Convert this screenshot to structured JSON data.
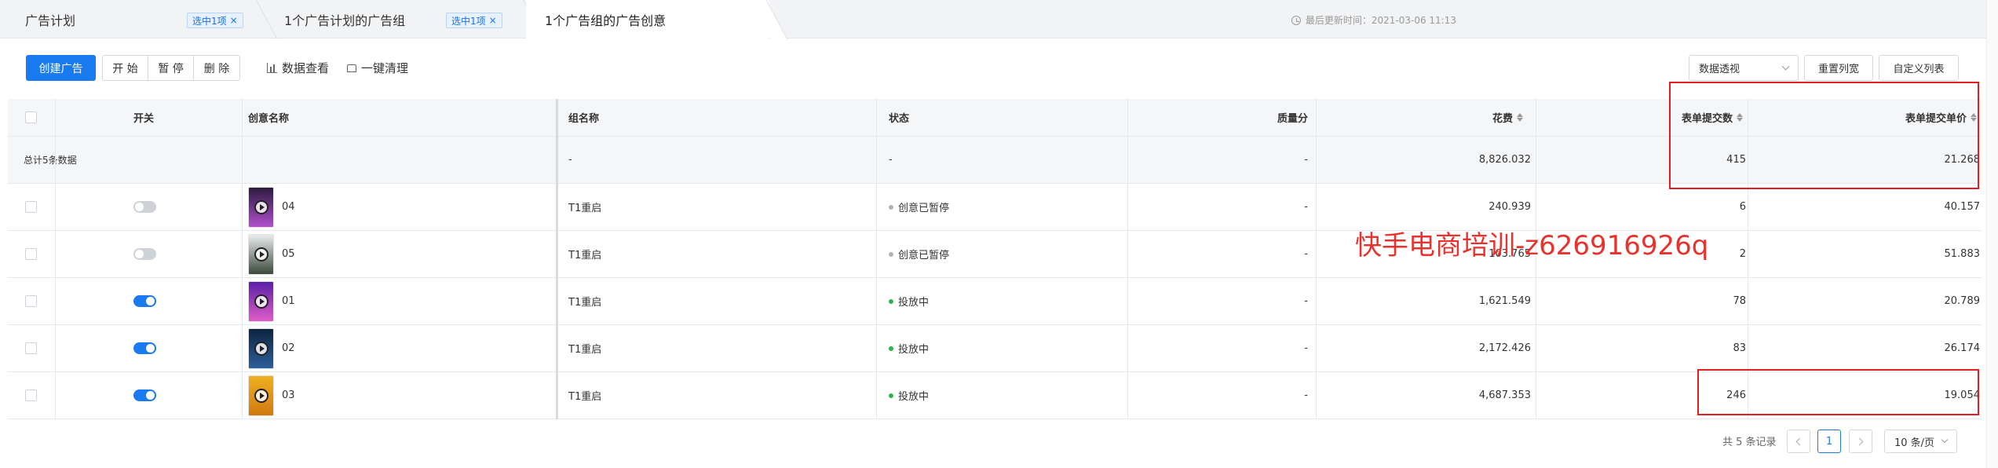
{
  "tabs": [
    {
      "label": "广告计划",
      "badge": "选中1项"
    },
    {
      "label": "1个广告计划的广告组",
      "badge": "选中1项"
    },
    {
      "label": "1个广告组的广告创意",
      "badge": ""
    }
  ],
  "last_update": "最后更新时间：2021-03-06 11:13",
  "toolbar": {
    "create": "创建广告",
    "start": "开 始",
    "pause": "暂 停",
    "delete": "删 除",
    "data_view": "数据查看",
    "one_click_clean": "一键清理",
    "select_value": "数据透视",
    "reset_width": "重置列宽",
    "custom_columns": "自定义列表"
  },
  "columns": {
    "switch": "开关",
    "creative_name": "创意名称",
    "group_name": "组名称",
    "status": "状态",
    "quality": "质量分",
    "spend": "花费",
    "form_submits": "表单提交数",
    "form_unit_price": "表单提交单价"
  },
  "total_row": {
    "label": "总计5条数据",
    "group_name": "-",
    "status": "-",
    "quality": "-",
    "spend": "8,826.032",
    "form_submits": "415",
    "form_unit_price": "21.268"
  },
  "rows": [
    {
      "on": false,
      "name": "04",
      "group": "T1重启",
      "status": "创意已暂停",
      "status_color": "#b0b3b8",
      "quality": "-",
      "spend": "240.939",
      "submits": "6",
      "unit_price": "40.157",
      "thumb_colors": [
        "#2b1b3d",
        "#b24fd0"
      ]
    },
    {
      "on": false,
      "name": "05",
      "group": "T1重启",
      "status": "创意已暂停",
      "status_color": "#b0b3b8",
      "quality": "-",
      "spend": "103.765",
      "submits": "2",
      "unit_price": "51.883",
      "thumb_colors": [
        "#e9ecef",
        "#3a4a3a"
      ]
    },
    {
      "on": true,
      "name": "01",
      "group": "T1重启",
      "status": "投放中",
      "status_color": "#2bb24c",
      "quality": "-",
      "spend": "1,621.549",
      "submits": "78",
      "unit_price": "20.789",
      "thumb_colors": [
        "#5a1fa8",
        "#e05cc8"
      ]
    },
    {
      "on": true,
      "name": "02",
      "group": "T1重启",
      "status": "投放中",
      "status_color": "#2bb24c",
      "quality": "-",
      "spend": "2,172.426",
      "submits": "83",
      "unit_price": "26.174",
      "thumb_colors": [
        "#0e2440",
        "#2c5f9a"
      ]
    },
    {
      "on": true,
      "name": "03",
      "group": "T1重启",
      "status": "投放中",
      "status_color": "#2bb24c",
      "quality": "-",
      "spend": "4,687.353",
      "submits": "246",
      "unit_price": "19.054",
      "thumb_colors": [
        "#f0b020",
        "#d07a10"
      ]
    }
  ],
  "watermark": "快手电商培训-z626916926q",
  "pagination": {
    "total_text": "共 5 条记录",
    "current_page": "1",
    "page_size": "10 条/页"
  }
}
